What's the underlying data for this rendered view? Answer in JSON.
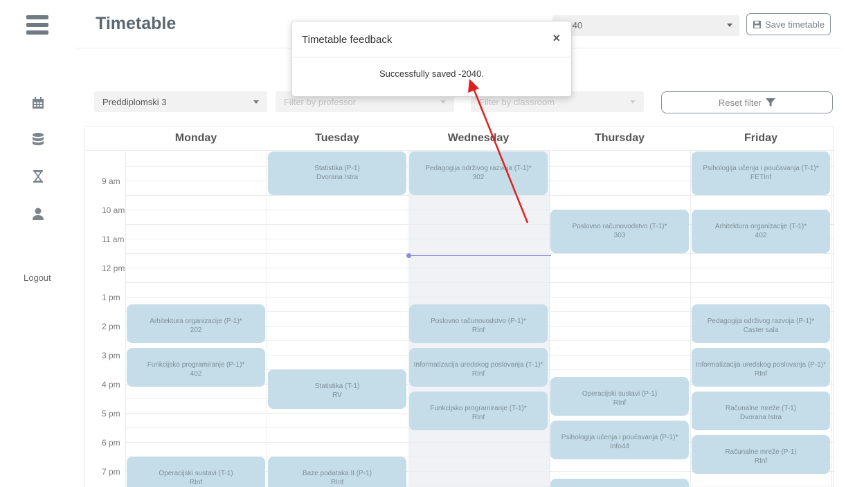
{
  "header": {
    "title": "Timetable",
    "timetable_select_value": "-2040",
    "save_label": "Save timetable"
  },
  "sidebar": {
    "icons": [
      "calendar-icon",
      "database-icon",
      "hourglass-icon",
      "user-icon"
    ],
    "logout_label": "Logout"
  },
  "filters": {
    "group_value": "Preddiplomski 3",
    "professor_placeholder": "Filter by professor",
    "classroom_placeholder": "Filter by classroom",
    "reset_label": "Reset filter"
  },
  "days": [
    "Monday",
    "Tuesday",
    "Wednesday",
    "Thursday",
    "Friday"
  ],
  "hours": [
    "9 am",
    "10 am",
    "11 am",
    "12 pm",
    "1 pm",
    "2 pm",
    "3 pm",
    "4 pm",
    "5 pm",
    "6 pm",
    "7 pm"
  ],
  "events": [
    {
      "day": 1,
      "start": 8.0,
      "end": 9.5,
      "title": "Statistika (P-1)",
      "room": "Dvorana Istra"
    },
    {
      "day": 2,
      "start": 8.0,
      "end": 9.5,
      "title": "Pedagogija održivog razvoja (T-1)*",
      "room": "302"
    },
    {
      "day": 4,
      "start": 8.0,
      "end": 9.5,
      "title": "Psihologija učenja i poučavanja (T-1)*",
      "room": "FETInf"
    },
    {
      "day": 3,
      "start": 10.0,
      "end": 11.5,
      "title": "Poslovno računovodstvo (T-1)*",
      "room": "303"
    },
    {
      "day": 4,
      "start": 10.0,
      "end": 11.5,
      "title": "Arhitektura organizacije (T-1)*",
      "room": "402"
    },
    {
      "day": 0,
      "start": 13.25,
      "end": 14.6,
      "title": "Arhitektura organizacije (P-1)*",
      "room": "202"
    },
    {
      "day": 2,
      "start": 13.25,
      "end": 14.6,
      "title": "Poslovno računovodstvo (P-1)*",
      "room": "RInf"
    },
    {
      "day": 4,
      "start": 13.25,
      "end": 14.6,
      "title": "Pedagogija održivog razvoja (P-1)*",
      "room": "Caster sala"
    },
    {
      "day": 0,
      "start": 14.75,
      "end": 16.1,
      "title": "Funkcijsko programiranje (P-1)*",
      "room": "402"
    },
    {
      "day": 2,
      "start": 14.75,
      "end": 16.1,
      "title": "Informatizacija uredskog poslovanja (T-1)*",
      "room": "RInf"
    },
    {
      "day": 4,
      "start": 14.75,
      "end": 16.1,
      "title": "Informatizacija uredskog poslovanja (P-1)*",
      "room": "RInf"
    },
    {
      "day": 1,
      "start": 15.5,
      "end": 16.85,
      "title": "Statistika (T-1)",
      "room": "RV"
    },
    {
      "day": 3,
      "start": 15.75,
      "end": 17.1,
      "title": "Operacijski sustavi (P-1)",
      "room": "RInf"
    },
    {
      "day": 2,
      "start": 16.25,
      "end": 17.6,
      "title": "Funkcijsko programiranje (T-1)*",
      "room": "RInf"
    },
    {
      "day": 4,
      "start": 16.25,
      "end": 17.6,
      "title": "Računalne mreže (T-1)",
      "room": "Dvorana Istra"
    },
    {
      "day": 3,
      "start": 17.25,
      "end": 18.6,
      "title": "Psihologija učenja i poučavanja (P-1)*",
      "room": "Info44"
    },
    {
      "day": 4,
      "start": 17.75,
      "end": 19.1,
      "title": "Računalne mreže (P-1)",
      "room": "RInf"
    },
    {
      "day": 0,
      "start": 18.5,
      "end": 20.0,
      "title": "Operacijski sustavi (T-1)",
      "room": "RInf"
    },
    {
      "day": 1,
      "start": 18.5,
      "end": 20.0,
      "title": "Baze podataka II (P-1)",
      "room": "RInf"
    },
    {
      "day": 3,
      "start": 19.25,
      "end": 20.5,
      "title": "",
      "room": ""
    }
  ],
  "modal": {
    "title": "Timetable feedback",
    "close_label": "×",
    "message": "Successfully saved -2040."
  },
  "colors": {
    "event_bg": "#c5dde8",
    "annotation_arrow": "#e02020",
    "now_indicator": "#8b8fd8"
  }
}
